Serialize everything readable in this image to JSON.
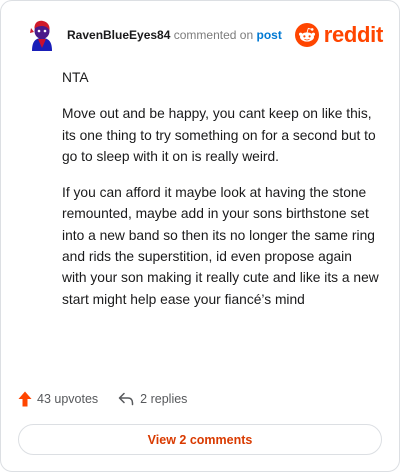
{
  "header": {
    "username": "RavenBlueEyes84",
    "action_text": "commented on",
    "post_link": "post",
    "brand_name": "reddit"
  },
  "comment": {
    "paragraphs": [
      "NTA",
      "Move out and be happy, you cant keep on like this, its one thing to try something on for a second but to go to sleep with it on is really weird.",
      "If you can afford it maybe look at having the stone remounted, maybe add in your sons birthstone set into a new band so then its no longer the same ring and rids the superstition, id even propose again with your son making it really cute and like its a new start might help ease your fiancé’s mind"
    ]
  },
  "actions": {
    "upvotes": "43 upvotes",
    "replies": "2 replies"
  },
  "view_comments_label": "View 2 comments",
  "colors": {
    "brand": "#ff4500",
    "link": "#0079d3",
    "view_button_text": "#d93a00",
    "text": "#1a1a1b",
    "muted": "#57595c"
  },
  "icons": {
    "avatar": "avatar",
    "brand": "reddit-logo-icon",
    "upvote": "upvote-arrow-icon",
    "reply": "reply-arrow-icon"
  }
}
